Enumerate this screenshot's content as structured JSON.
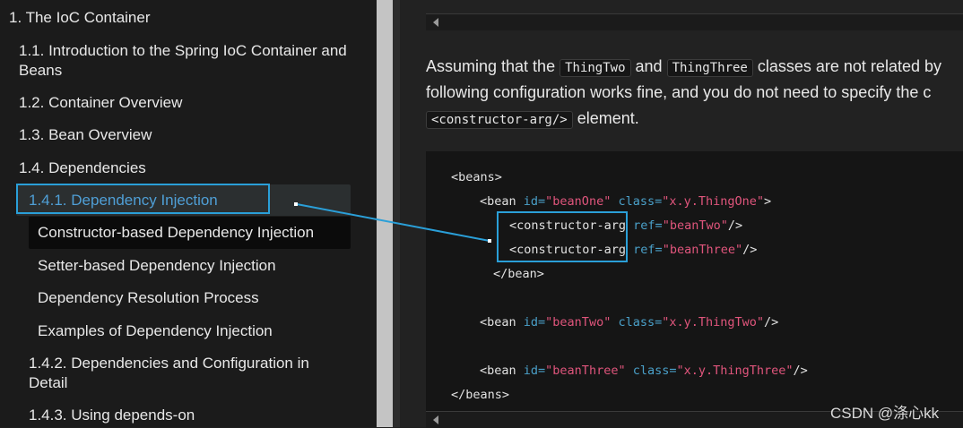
{
  "sidebar": {
    "items": [
      {
        "label": "1. The IoC Container"
      },
      {
        "label": "1.1. Introduction to the Spring IoC Container and Beans"
      },
      {
        "label": "1.2. Container Overview"
      },
      {
        "label": "1.3. Bean Overview"
      },
      {
        "label": "1.4. Dependencies"
      },
      {
        "label": "1.4.1. Dependency Injection"
      },
      {
        "label": "Constructor-based Dependency Injection"
      },
      {
        "label": "Setter-based Dependency Injection"
      },
      {
        "label": "Dependency Resolution Process"
      },
      {
        "label": "Examples of Dependency Injection"
      },
      {
        "label": "1.4.2. Dependencies and Configuration in Detail"
      },
      {
        "label": "1.4.3. Using depends-on"
      }
    ],
    "active_color": "#4f9fd6"
  },
  "content": {
    "para": {
      "t1": "Assuming that the ",
      "code1": "ThingTwo",
      "t2": " and ",
      "code2": "ThingThree",
      "t3": " classes are not related by",
      "line2": "following configuration works fine, and you do not need to specify the c",
      "code3": "<constructor-arg/>",
      "t4": " element."
    },
    "code": {
      "l1": "<beans>",
      "l2_open": "<bean ",
      "l2_attr1": "id=",
      "l2_val1": "\"beanOne\"",
      "l2_attr2": " class=",
      "l2_val2": "\"x.y.ThingOne\"",
      "l2_close": ">",
      "l3_tag": "<constructor-arg",
      "l3_attr": " ref=",
      "l3_val": "\"beanTwo\"",
      "l3_close": "/>",
      "l4_tag": "<constructor-arg",
      "l4_attr": " ref=",
      "l4_val": "\"beanThree\"",
      "l4_close": "/>",
      "l5": "</bean>",
      "l6_open": "<bean ",
      "l6_attr1": "id=",
      "l6_val1": "\"beanTwo\"",
      "l6_attr2": " class=",
      "l6_val2": "\"x.y.ThingTwo\"",
      "l6_close": "/>",
      "l7_open": "<bean ",
      "l7_attr1": "id=",
      "l7_val1": "\"beanThree\"",
      "l7_attr2": " class=",
      "l7_val2": "\"x.y.ThingThree\"",
      "l7_close": "/>",
      "l8": "</beans>"
    }
  },
  "watermark": "CSDN @涤心kk",
  "colors": {
    "highlight_border": "#2a9fd8",
    "code_attr": "#4aa0c9",
    "code_value": "#e0557c"
  }
}
